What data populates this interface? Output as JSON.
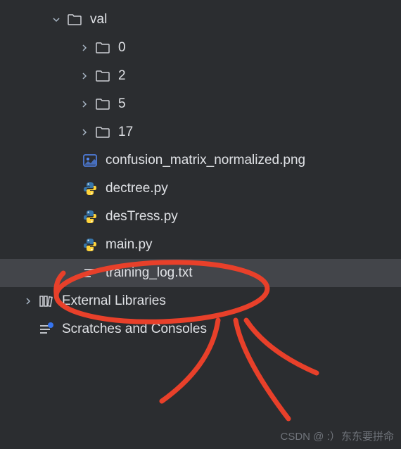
{
  "tree": {
    "val": "val",
    "folders": [
      "0",
      "2",
      "5",
      "17"
    ],
    "files": {
      "confusion": "confusion_matrix_normalized.png",
      "dectree": "dectree.py",
      "destress": "desTress.py",
      "main": "main.py",
      "training_log": "training_log.txt"
    },
    "external": "External Libraries",
    "scratches": "Scratches and Consoles"
  },
  "watermark": "CSDN @ :） 东东要拼命"
}
